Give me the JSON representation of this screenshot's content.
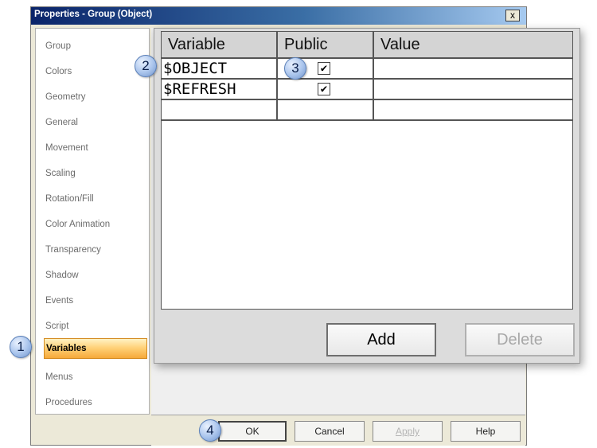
{
  "window": {
    "title": "Properties - Group (Object)",
    "close_label": "x"
  },
  "sidebar": {
    "items": [
      {
        "label": "Group"
      },
      {
        "label": "Colors"
      },
      {
        "label": "Geometry"
      },
      {
        "label": "General"
      },
      {
        "label": "Movement"
      },
      {
        "label": "Scaling"
      },
      {
        "label": "Rotation/Fill"
      },
      {
        "label": "Color Animation"
      },
      {
        "label": "Transparency"
      },
      {
        "label": "Shadow"
      },
      {
        "label": "Events"
      },
      {
        "label": "Script"
      },
      {
        "label": "Variables",
        "selected": true
      },
      {
        "label": "Menus"
      },
      {
        "label": "Procedures"
      }
    ]
  },
  "variables_table": {
    "columns": [
      "Variable",
      "Public",
      "Value"
    ],
    "rows": [
      {
        "variable": "$OBJECT",
        "public": true,
        "value": ""
      },
      {
        "variable": "$REFRESH",
        "public": true,
        "value": ""
      },
      {
        "variable": "",
        "public": false,
        "value": ""
      }
    ],
    "check_glyph": "✔"
  },
  "panel_buttons": {
    "add": "Add",
    "delete": "Delete"
  },
  "dialog_buttons": {
    "ok": "OK",
    "cancel": "Cancel",
    "apply": "Apply",
    "help": "Help"
  },
  "callouts": [
    "1",
    "2",
    "3",
    "4"
  ],
  "colors": {
    "selected_item": "#ffd27a",
    "callout": "#a9c4ec",
    "titlebar": "#0a246a"
  }
}
